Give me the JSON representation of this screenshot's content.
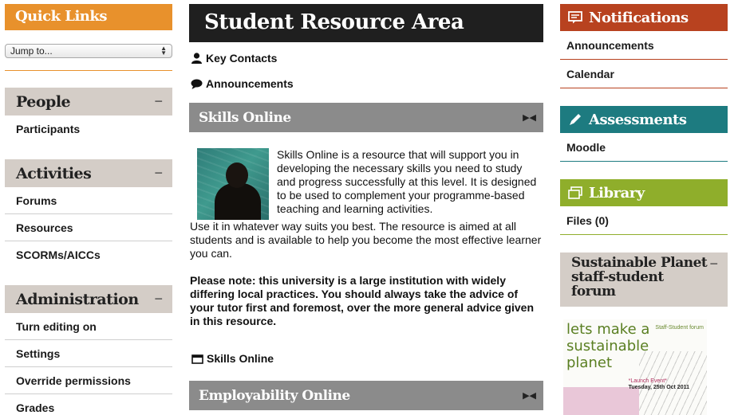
{
  "left": {
    "quick_links": {
      "title": "Quick Links",
      "select_value": "Jump to..."
    },
    "people": {
      "title": "People",
      "items": [
        "Participants"
      ]
    },
    "activities": {
      "title": "Activities",
      "items": [
        "Forums",
        "Resources",
        "SCORMs/AICCs"
      ]
    },
    "administration": {
      "title": "Administration",
      "items": [
        "Turn editing on",
        "Settings",
        "Override permissions",
        "Grades"
      ]
    }
  },
  "main": {
    "title": "Student Resource Area",
    "links": [
      "Key Contacts",
      "Announcements"
    ],
    "skills": {
      "title": "Skills Online",
      "intro": "Skills Online is a resource that will support you in developing the necessary skills you need to study and progress successfully at this level. It is designed to be used to complement your programme-based teaching and learning activities.",
      "para": "Use it in whatever way suits you best. The resource is aimed at all students and is available to help you become the most effective learner you can.",
      "note": "Please note: this university is a large institution with widely differing local practices. You should always take the advice of your tutor first and foremost, over the more general advice given in this resource.",
      "link": "Skills Online"
    },
    "employability": {
      "title": "Employability Online"
    }
  },
  "right": {
    "notifications": {
      "title": "Notifications",
      "items": [
        "Announcements",
        "Calendar"
      ],
      "color": "#b8421f"
    },
    "assessments": {
      "title": "Assessments",
      "items": [
        "Moodle"
      ],
      "color": "#1d7b80"
    },
    "library": {
      "title": "Library",
      "items": [
        "Files (0)"
      ],
      "color": "#8fae2b"
    },
    "forum": {
      "title": "Sustainable Planet staff-student forum",
      "poster": {
        "headline": "lets make a sustainable planet",
        "corner": "Staff-Student forum",
        "launch": "*Launch Event*",
        "date": "Tuesday, 25th Oct 2011"
      }
    }
  },
  "colors": {
    "quick_links": "#e8912c",
    "block_head": "#d4cdc7",
    "title_bar": "#1f1f1f",
    "section_bar": "#8b8b8b"
  }
}
